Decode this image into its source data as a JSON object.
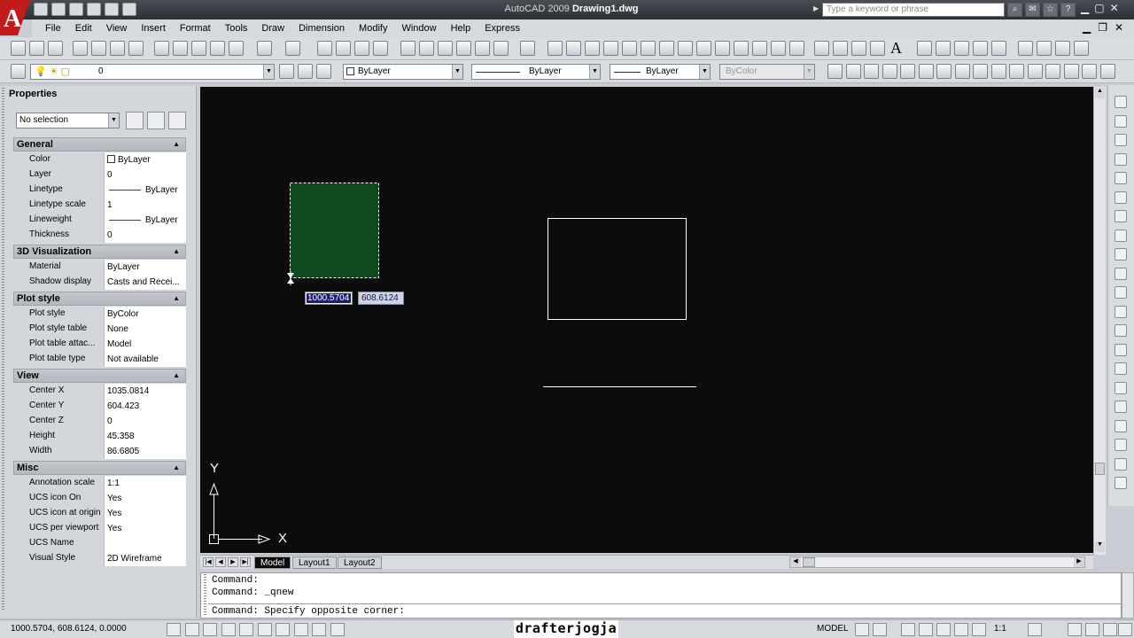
{
  "window": {
    "title_prefix": "AutoCAD 2009",
    "title_file": "Drawing1.dwg",
    "search_placeholder": "Type a keyword or phrase"
  },
  "menu": [
    "File",
    "Edit",
    "View",
    "Insert",
    "Format",
    "Tools",
    "Draw",
    "Dimension",
    "Modify",
    "Window",
    "Help",
    "Express"
  ],
  "layers_toolbar": {
    "layer_value": "0",
    "color_value": "ByLayer",
    "linetype_value": "ByLayer",
    "lineweight_value": "ByLayer",
    "plotstyle_value": "ByColor"
  },
  "properties": {
    "title": "Properties",
    "selection": "No selection",
    "sections": [
      {
        "name": "General",
        "rows": [
          {
            "key": "Color",
            "value": "ByLayer",
            "sample": "square"
          },
          {
            "key": "Layer",
            "value": "0"
          },
          {
            "key": "Linetype",
            "value": "ByLayer",
            "sample": "line"
          },
          {
            "key": "Linetype scale",
            "value": "1"
          },
          {
            "key": "Lineweight",
            "value": "ByLayer",
            "sample": "line"
          },
          {
            "key": "Thickness",
            "value": "0"
          }
        ]
      },
      {
        "name": "3D Visualization",
        "rows": [
          {
            "key": "Material",
            "value": "ByLayer"
          },
          {
            "key": "Shadow display",
            "value": "Casts and Recei..."
          }
        ]
      },
      {
        "name": "Plot style",
        "rows": [
          {
            "key": "Plot style",
            "value": "ByColor"
          },
          {
            "key": "Plot style table",
            "value": "None"
          },
          {
            "key": "Plot table attac...",
            "value": "Model"
          },
          {
            "key": "Plot table type",
            "value": "Not available"
          }
        ]
      },
      {
        "name": "View",
        "rows": [
          {
            "key": "Center X",
            "value": "1035.0814"
          },
          {
            "key": "Center Y",
            "value": "604.423"
          },
          {
            "key": "Center Z",
            "value": "0"
          },
          {
            "key": "Height",
            "value": "45.358"
          },
          {
            "key": "Width",
            "value": "86.6805"
          }
        ]
      },
      {
        "name": "Misc",
        "rows": [
          {
            "key": "Annotation scale",
            "value": "1:1"
          },
          {
            "key": "UCS icon On",
            "value": "Yes"
          },
          {
            "key": "UCS icon at origin",
            "value": "Yes"
          },
          {
            "key": "UCS per viewport",
            "value": "Yes"
          },
          {
            "key": "UCS Name",
            "value": ""
          },
          {
            "key": "Visual Style",
            "value": "2D Wireframe"
          }
        ]
      }
    ]
  },
  "drawing": {
    "dyn_input_x": "1000.5704",
    "dyn_input_y": "608.6124",
    "ucs_x_label": "X",
    "ucs_y_label": "Y",
    "selection_fill_color": "#0f4a1e",
    "background_color": "#0c0c0c"
  },
  "layout_tabs": [
    "Model",
    "Layout1",
    "Layout2"
  ],
  "command_line": {
    "lines": [
      "Command:",
      "Command: _qnew"
    ],
    "prompt": "Command: Specify opposite corner:"
  },
  "status": {
    "coordinates": "1000.5704, 608.6124, 0.0000",
    "model_label": "MODEL",
    "annotation_scale": "1:1",
    "watermark": "drafterjogja"
  }
}
